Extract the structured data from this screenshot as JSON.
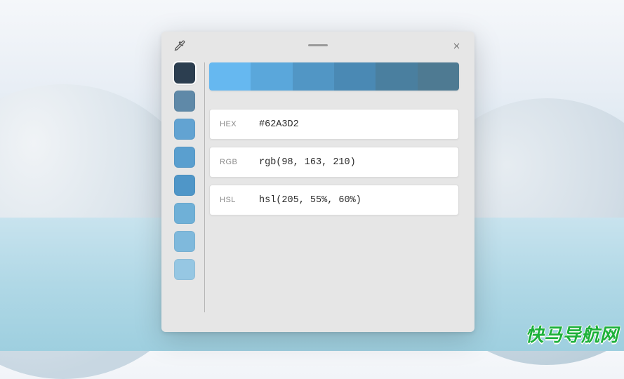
{
  "titlebar": {
    "eyedropper_icon": "eyedropper-icon",
    "close_icon": "close-icon"
  },
  "history": {
    "swatches": [
      {
        "color": "#2c3e50",
        "selected": true
      },
      {
        "color": "#5f89a8",
        "selected": false
      },
      {
        "color": "#62a3d2",
        "selected": false
      },
      {
        "color": "#5a9fcf",
        "selected": false
      },
      {
        "color": "#4f96c8",
        "selected": false
      },
      {
        "color": "#6fb0d7",
        "selected": false
      },
      {
        "color": "#7fb9dc",
        "selected": false
      },
      {
        "color": "#96c7e3",
        "selected": false
      }
    ]
  },
  "shades": [
    "#66b8f0",
    "#5aa7db",
    "#5196c5",
    "#4a89b4",
    "#4a7f9f",
    "#4e7a92"
  ],
  "values": {
    "hex": {
      "label": "HEX",
      "value": "#62A3D2"
    },
    "rgb": {
      "label": "RGB",
      "value": "rgb(98, 163, 210)"
    },
    "hsl": {
      "label": "HSL",
      "value": "hsl(205, 55%, 60%)"
    }
  },
  "watermark": "快马导航网"
}
